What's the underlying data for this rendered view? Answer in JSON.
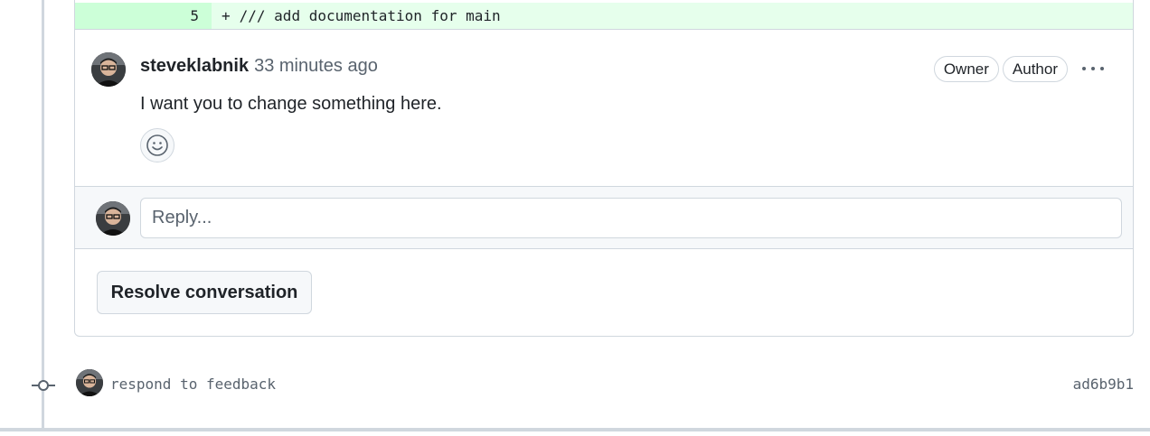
{
  "diff": {
    "line_number": "5",
    "sign": "+",
    "code": "/// add documentation for main"
  },
  "comment": {
    "author": "steveklabnik",
    "timestamp": "33 minutes ago",
    "badges": [
      "Owner",
      "Author"
    ],
    "body": "I want you to change something here.",
    "avatar_icon": "user-avatar",
    "more_icon": "kebab-horizontal-icon",
    "reaction_icon": "smiley-icon"
  },
  "reply": {
    "placeholder": "Reply..."
  },
  "resolve": {
    "label": "Resolve conversation"
  },
  "commit": {
    "message": "respond to feedback",
    "sha": "ad6b9b1",
    "node_icon": "git-commit-icon"
  },
  "colors": {
    "addition_bg": "#e6ffec",
    "addition_num_bg": "#ccffd8",
    "border": "#d0d7de",
    "muted_text": "#59636e"
  }
}
